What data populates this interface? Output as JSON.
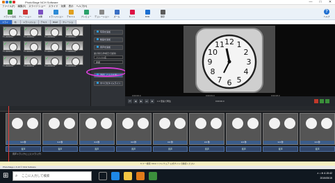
{
  "titlebar": {
    "title": "PhotoStage NCH Software",
    "minimize": "—",
    "maximize": "□",
    "close": "✕"
  },
  "menu": [
    "ファイル(F)",
    "編集(E)",
    "スライドショー",
    "スライド",
    "効果",
    "表示",
    "ヘルプ(H)"
  ],
  "toolbar": [
    {
      "label": "スライド追加",
      "icon": "add-slides-icon",
      "color": "#3c8f3c"
    },
    {
      "label": "ナレーション",
      "icon": "narration-icon",
      "color": "#c33"
    },
    {
      "label": "効果",
      "icon": "effects-icon",
      "color": "#7a4fc0"
    },
    {
      "label": "トランジション",
      "icon": "transition-icon",
      "color": "#2e8bd6"
    },
    {
      "label": "テキスト",
      "icon": "text-icon",
      "color": "#e0a020"
    },
    {
      "label": "プレビュー",
      "icon": "preview-icon",
      "color": "#2aa06a"
    },
    {
      "label": "デュレーション",
      "icon": "duration-icon",
      "color": "#888"
    },
    {
      "label": "ズーム",
      "icon": "zoom-icon",
      "color": "#3a6fc4"
    },
    {
      "label": "カット",
      "icon": "cut-icon",
      "color": "#d14"
    },
    {
      "label": "DVD",
      "icon": "dvd-icon",
      "color": "#1b6fd1"
    },
    {
      "label": "保存",
      "icon": "save-icon",
      "color": "#5b5b5b"
    }
  ],
  "help": {
    "label": "ヘルプ",
    "glyph": "?"
  },
  "tabs": [
    "スライド",
    "効果",
    "トランジション",
    "テキスト",
    "BGM",
    "ナレーション"
  ],
  "bin_clips": [
    "TX-00090001",
    "TX-00090002",
    "TX-00090003",
    "TX-00090004",
    "TX-00090005",
    "TX-00090006",
    "TX-00090007",
    "TX-00090008",
    "TX-00090009",
    "TX-00090010",
    "TX-00090011",
    "TX-00090012"
  ],
  "side": {
    "btn1": "写真を追加",
    "btn2": "動画を追加",
    "btn3": "音声を追加",
    "dropdown1_label": "並び替え(作成日で並替)",
    "dropdown2": "ファイル名",
    "dropdown3": "昇順",
    "btn4": "選択したものを挿入",
    "btn5": "すべてをタイムライン"
  },
  "preview": {
    "label_left": "0:00:00.0",
    "label_mid": "0:00:03.0",
    "label_right": "0:00:08.0",
    "clock_numbers": [
      "12",
      "1",
      "2",
      "3",
      "4",
      "5",
      "6",
      "7",
      "8",
      "9",
      "10",
      "11"
    ]
  },
  "transport": {
    "buttons": [
      "⏮",
      "◀",
      "▶",
      "⏭",
      "■"
    ],
    "speed": "1.0 倍速で再生",
    "time": "0:00:00.0"
  },
  "timeline": {
    "clip_label": "3.0 秒",
    "clip_count": 9,
    "audio_label": "音声",
    "track_label": "音声トラック(ここにドラッグ)"
  },
  "bottom": {
    "notice": "ヤフー検索: NCH ソフトウェア 公式サイトで確認ください",
    "status": "PhotoStage v 6.10 © NCH Software"
  },
  "taskbar": {
    "search_placeholder": "ここに入力して検索",
    "time": "15:42",
    "date": "2019/05/15",
    "tray": "∧ ♪ ⊕ A"
  }
}
